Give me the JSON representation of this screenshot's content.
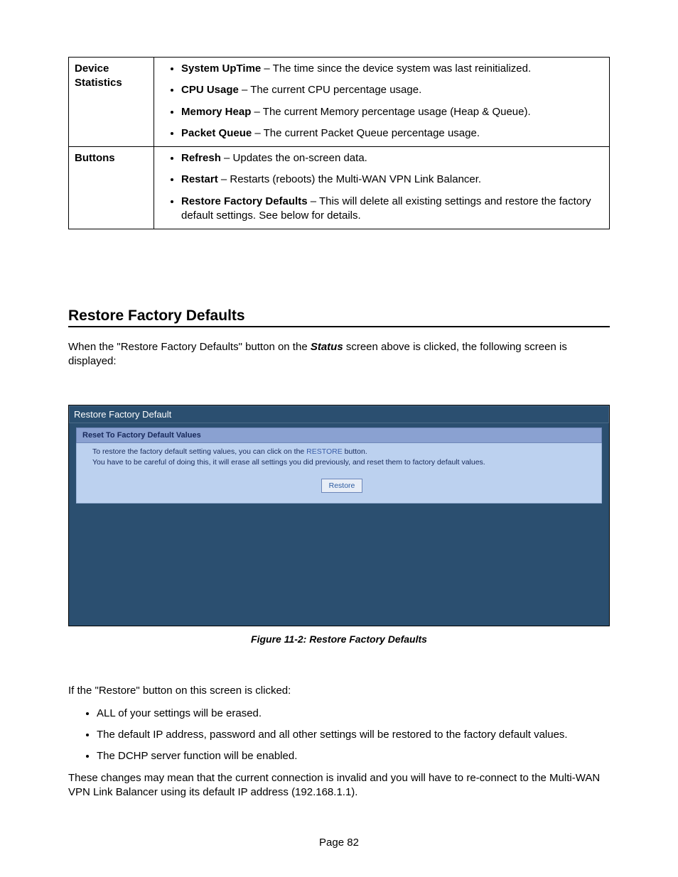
{
  "table": {
    "row1": {
      "label_line1": "Device",
      "label_line2": "Statistics",
      "items": {
        "i0": {
          "term": "System UpTime",
          "desc": " – The time since the device system was last reinitialized."
        },
        "i1": {
          "term": "CPU Usage",
          "desc": " – The current CPU percentage usage."
        },
        "i2": {
          "term": "Memory Heap",
          "desc": " – The current Memory percentage usage (Heap & Queue)."
        },
        "i3": {
          "term": "Packet Queue",
          "desc": " – The current Packet Queue percentage usage."
        }
      }
    },
    "row2": {
      "label": "Buttons",
      "items": {
        "i0": {
          "term": "Refresh",
          "desc": " – Updates the on-screen data."
        },
        "i1": {
          "term": "Restart",
          "desc": " – Restarts (reboots) the Multi-WAN VPN Link Balancer."
        },
        "i2": {
          "term": "Restore Factory Defaults",
          "desc": " – This will delete all existing settings and restore the factory default settings. See below for details."
        }
      }
    }
  },
  "section_heading": "Restore Factory Defaults",
  "intro": {
    "p1a": "When the \"Restore Factory Defaults\" button on the ",
    "p1b": "Status",
    "p1c": " screen above is clicked, the following screen is displayed:"
  },
  "screenshot": {
    "title": "Restore Factory Default",
    "panel_head": "Reset To Factory Default Values",
    "line1a": "To restore the factory default setting values, you can click on the ",
    "line1b": "RESTORE",
    "line1c": " button.",
    "line2": "You have to be careful of doing this, it will erase all settings you did previously, and reset them to factory default values.",
    "restore_button": "Restore"
  },
  "figure_caption": "Figure 11-2: Restore Factory Defaults",
  "after": {
    "p1": "If the \"Restore\" button on this screen is clicked:",
    "bullets": {
      "b0": "ALL of your settings will be erased.",
      "b1": "The default IP address, password and all other settings will be restored to the factory default values.",
      "b2": "The DCHP server function will be enabled."
    },
    "p2": "These changes may mean that the current connection is invalid and you will have to re-connect to the Multi-WAN VPN Link Balancer using its default IP address (192.168.1.1)."
  },
  "page_number": "Page 82"
}
